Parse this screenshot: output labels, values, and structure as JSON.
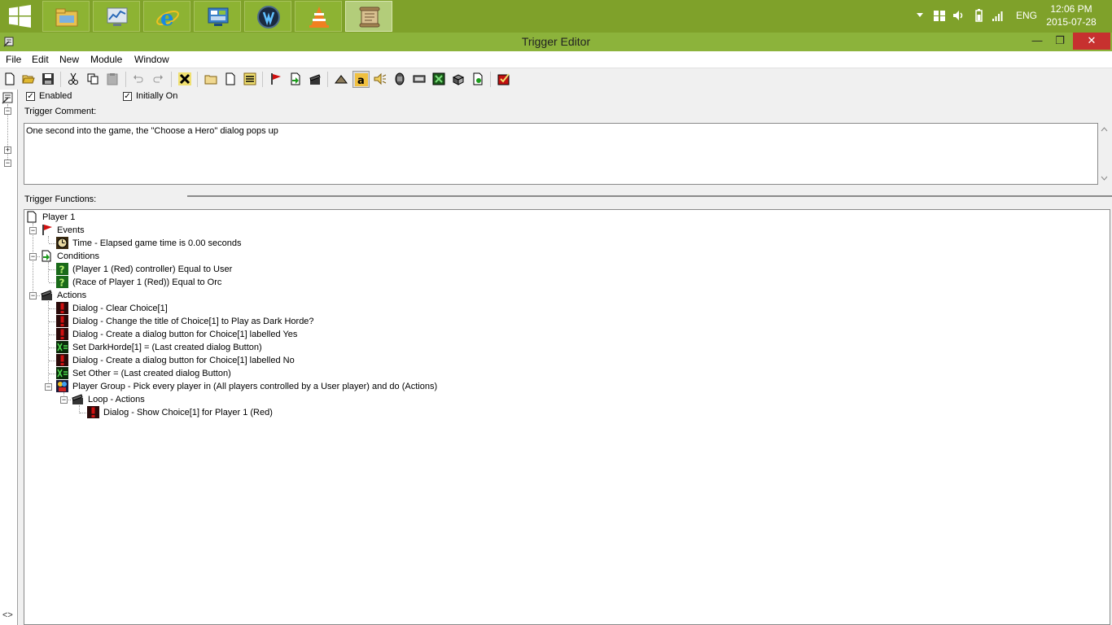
{
  "taskbar": {
    "clock_time": "12:06 PM",
    "clock_date": "2015-07-28",
    "language": "ENG"
  },
  "window": {
    "title": "Trigger Editor",
    "minimize": "—",
    "maximize": "❐",
    "close": "✕"
  },
  "menu": [
    "File",
    "Edit",
    "New",
    "Module",
    "Window"
  ],
  "options": {
    "enabled_label": "Enabled",
    "initially_on_label": "Initially On",
    "check_mark": "✓"
  },
  "comment": {
    "label": "Trigger Comment:",
    "text": "One second into the game, the \"Choose a Hero\" dialog pops up"
  },
  "functions": {
    "label": "Trigger Functions:",
    "root": "Player 1",
    "events_label": "Events",
    "events": [
      "Time - Elapsed game time is 0.00 seconds"
    ],
    "conditions_label": "Conditions",
    "conditions": [
      "(Player 1 (Red) controller) Equal to User",
      "(Race of Player 1 (Red)) Equal to Orc"
    ],
    "actions_label": "Actions",
    "actions": [
      "Dialog - Clear Choice[1]",
      "Dialog - Change the title of Choice[1] to Play as Dark Horde?",
      "Dialog - Create a dialog button for Choice[1] labelled Yes",
      "Set DarkHorde[1] = (Last created dialog Button)",
      "Dialog - Create a dialog button for Choice[1] labelled No",
      "Set Other = (Last created dialog Button)",
      "Player Group - Pick every player in (All players controlled by a User player) and do (Actions)"
    ],
    "loop_label": "Loop - Actions",
    "loop_actions": [
      "Dialog - Show Choice[1] for Player 1 (Red)"
    ]
  },
  "colors": {
    "taskbar": "#7fa12a",
    "titlebar": "#8cb33b",
    "close_button": "#c7312f",
    "action_icon_red": "#cc0000",
    "condition_icon_green": "#1a7a1a"
  }
}
